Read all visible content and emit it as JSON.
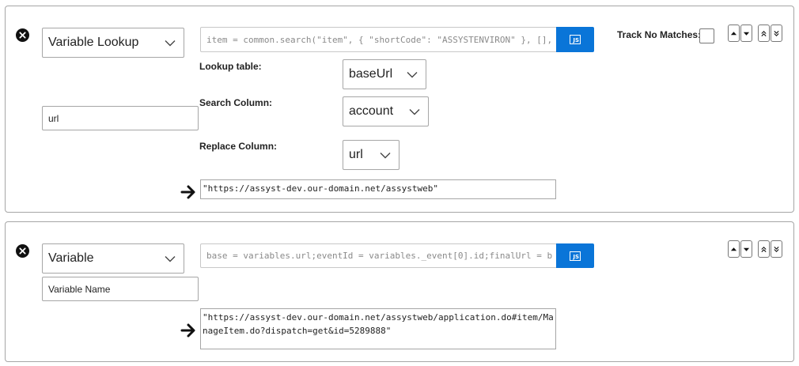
{
  "steps": [
    {
      "type_label": "Variable Lookup",
      "name_value": "url",
      "code": "item = common.search(\"item\", { \"shortCode\": \"ASSYSTENVIRON\" }, [],",
      "js_label": "JS",
      "track_no_matches_label": "Track No Matches:",
      "lookup_table_label": "Lookup table:",
      "lookup_table_value": "baseUrl",
      "search_column_label": "Search Column:",
      "search_column_value": "account",
      "replace_column_label": "Replace Column:",
      "replace_column_value": "url",
      "output": "\"https://assyst-dev.our-domain.net/assystweb\""
    },
    {
      "type_label": "Variable",
      "name_placeholder": "Variable Name",
      "code": "base = variables.url;eventId = variables._event[0].id;finalUrl = b",
      "js_label": "JS",
      "output": "\"https://assyst-dev.our-domain.net/assystweb/application.do#item/ManageItem.do?dispatch=get&id=5289888\""
    }
  ]
}
